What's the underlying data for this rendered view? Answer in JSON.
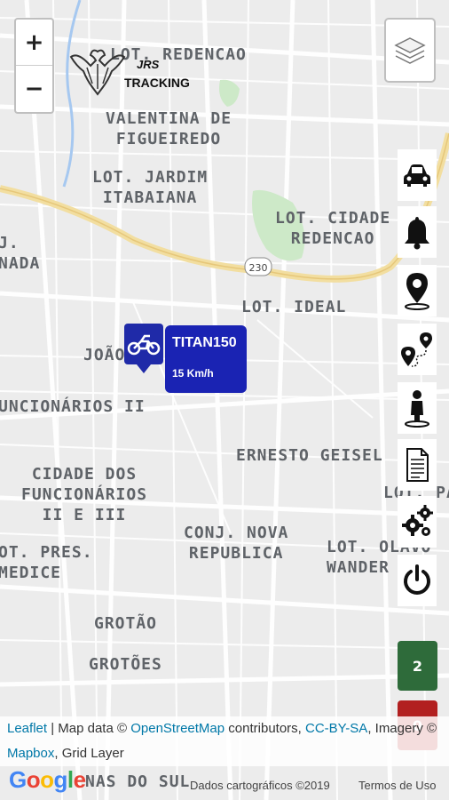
{
  "map": {
    "labels": [
      {
        "id": "lot-redencao",
        "text": "LOT. REDENCAO"
      },
      {
        "id": "valentina",
        "text": "VALENTINA DE\nFIGUEIREDO"
      },
      {
        "id": "jardim-itabaiana",
        "text": "LOT. JARDIM\nITABAIANA"
      },
      {
        "id": "cidade-redencao",
        "text": "LOT. CIDADE\nREDENCAO"
      },
      {
        "id": "nada",
        "text": "J.\nNADA"
      },
      {
        "id": "lot-ideal",
        "text": "LOT. IDEAL"
      },
      {
        "id": "joao",
        "text": "JOÃO"
      },
      {
        "id": "funcionarios-ii",
        "text": "UNCIONÁRIOS II"
      },
      {
        "id": "ernesto-geisel",
        "text": "ERNESTO GEISEL"
      },
      {
        "id": "lot-pa",
        "text": "LOT. PA"
      },
      {
        "id": "cidade-funcionarios",
        "text": "CIDADE DOS\nFUNCIONÁRIOS\nII E III"
      },
      {
        "id": "conj-nova",
        "text": "CONJ. NOVA\nREPUBLICA"
      },
      {
        "id": "lot-olavo",
        "text": "LOT. OLAVO\nWANDER"
      },
      {
        "id": "pres-medice",
        "text": "OT. PRES.\nMEDICE"
      },
      {
        "id": "grotao",
        "text": "GROTÃO"
      },
      {
        "id": "grotoes",
        "text": "GROTÕES"
      },
      {
        "id": "nas-do-sul",
        "text": "NAS DO SUL"
      }
    ],
    "road_shield": "230"
  },
  "zoom": {
    "in_label": "+",
    "out_label": "−"
  },
  "logo": {
    "line1": "JRS",
    "line2": "TRACKING"
  },
  "toolbar": [
    {
      "id": "car",
      "icon": "car-icon"
    },
    {
      "id": "bell",
      "icon": "bell-icon"
    },
    {
      "id": "pin",
      "icon": "map-pin-icon"
    },
    {
      "id": "route",
      "icon": "route-icon"
    },
    {
      "id": "person",
      "icon": "person-pin-icon"
    },
    {
      "id": "report",
      "icon": "document-icon"
    },
    {
      "id": "settings",
      "icon": "gears-icon"
    },
    {
      "id": "power",
      "icon": "power-icon"
    }
  ],
  "counters": {
    "online": "2",
    "offline": "0",
    "online_color": "#2e6b3a",
    "offline_color": "#b22020"
  },
  "vehicle": {
    "name": "TITAN150",
    "speed": "15 Km/h",
    "marker_color": "#1f2aa8"
  },
  "attribution": {
    "leaflet": "Leaflet",
    "sep": " | Map data © ",
    "osm": "OpenStreetMap",
    "contrib": " contributors, ",
    "ccbysa": "CC-BY-SA",
    "imagery": ", Imagery ©",
    "mapbox": "Mapbox",
    "grid": ", Grid Layer"
  },
  "google": {
    "logo": "Google",
    "dados": "Dados cartográficos ©2019",
    "termos": "Termos de Uso"
  }
}
